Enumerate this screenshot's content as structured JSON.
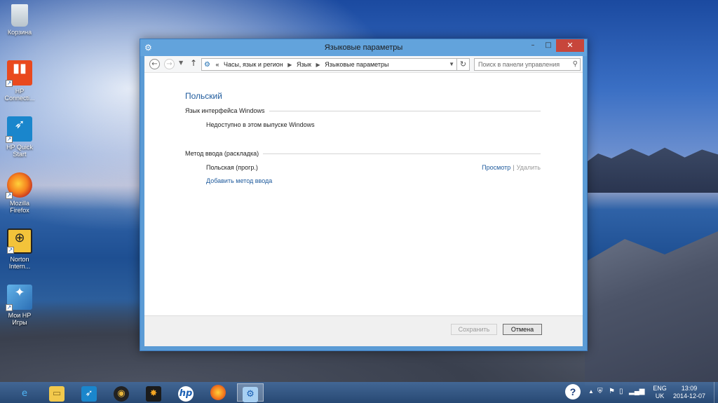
{
  "desktop": {
    "icons": [
      {
        "label": "Корзина",
        "icon": "recycle-bin-icon"
      },
      {
        "label": "HP Connecti...",
        "icon": "hp-connected-icon"
      },
      {
        "label": "HP Quick Start",
        "icon": "hp-quick-start-icon"
      },
      {
        "label": "Mozilla Firefox",
        "icon": "firefox-icon"
      },
      {
        "label": "Norton Intern...",
        "icon": "norton-icon"
      },
      {
        "label": "Мои HP Игры",
        "icon": "hp-games-icon"
      }
    ]
  },
  "window": {
    "title": "Языковые параметры",
    "controls": {
      "minimize": "–",
      "maximize": "□",
      "close": "✕"
    },
    "address": {
      "prefix": "«",
      "segments": [
        "Часы, язык и регион",
        "Язык",
        "Языковые параметры"
      ]
    },
    "search": {
      "placeholder": "Поиск в панели управления"
    },
    "content": {
      "language_name": "Польский",
      "ui_section": {
        "heading": "Язык интерфейса Windows",
        "text": "Недоступно в этом выпуске Windows"
      },
      "input_section": {
        "heading": "Метод ввода (раскладка)",
        "method": "Польская (прогр.)",
        "preview_link": "Просмотр",
        "separator": "|",
        "remove_link": "Удалить",
        "add_link": "Добавить метод ввода"
      }
    },
    "footer": {
      "save_label": "Сохранить",
      "cancel_label": "Отмена"
    }
  },
  "taskbar": {
    "items": [
      {
        "name": "internet-explorer-icon",
        "active": false
      },
      {
        "name": "file-explorer-icon",
        "active": false
      },
      {
        "name": "hp-quick-start-icon",
        "active": false
      },
      {
        "name": "media-player-icon",
        "active": false
      },
      {
        "name": "games-icon",
        "active": false
      },
      {
        "name": "hp-icon",
        "active": false
      },
      {
        "name": "firefox-icon",
        "active": false
      },
      {
        "name": "control-panel-icon",
        "active": true
      }
    ],
    "tray": {
      "help": "?",
      "lang_top": "ENG",
      "lang_bottom": "UK",
      "time": "13:09",
      "date": "2014-12-07"
    }
  },
  "colors": {
    "title_bar": "#62a3dc",
    "link": "#1e5a9c",
    "close_button": "#c7463b"
  }
}
